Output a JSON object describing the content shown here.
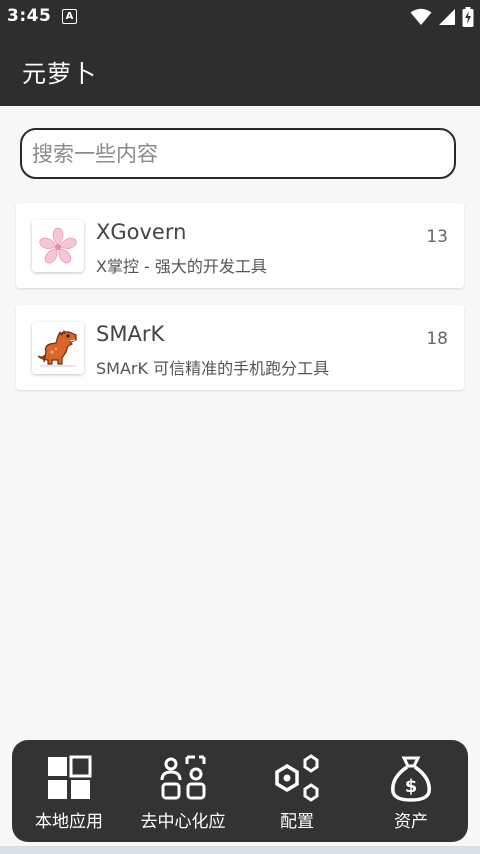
{
  "status_bar": {
    "time": "3:45",
    "notification_letter": "A",
    "icons": [
      "wifi-icon",
      "signal-icon",
      "battery-charging-icon"
    ]
  },
  "app_bar": {
    "title": "元萝卜"
  },
  "search": {
    "placeholder": "搜索一些内容",
    "value": ""
  },
  "apps": [
    {
      "name": "XGovern",
      "description": "X掌控 - 强大的开发工具",
      "count": "13",
      "icon": "sakura-flower-icon"
    },
    {
      "name": "SMArK",
      "description": "SMArK 可信精准的手机跑分工具",
      "count": "18",
      "icon": "dinosaur-icon"
    }
  ],
  "bottom_nav": [
    {
      "label": "本地应用",
      "icon": "grid-apps-icon"
    },
    {
      "label": "去中心化应",
      "icon": "decentralized-users-icon"
    },
    {
      "label": "配置",
      "icon": "hexagon-nodes-icon"
    },
    {
      "label": "资产",
      "icon": "money-bag-icon"
    }
  ],
  "colors": {
    "app_bar": "#2e2e2e",
    "background": "#f7f7f7",
    "nav_bar": "#333333",
    "sakura_pink": "#f7c6d6",
    "dino_orange": "#d9652b"
  }
}
